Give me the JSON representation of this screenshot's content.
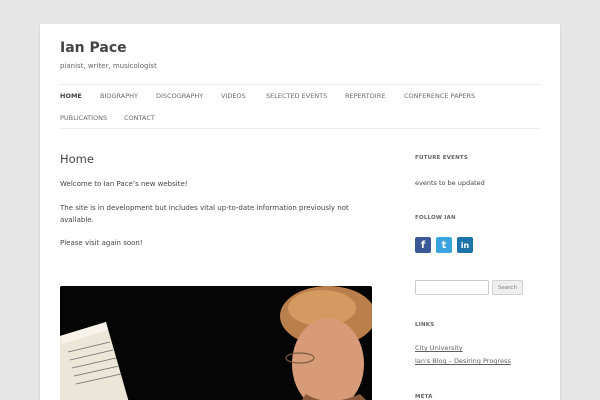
{
  "site": {
    "title": "Ian Pace",
    "description": "pianist, writer, musicologist"
  },
  "nav": {
    "items": [
      {
        "label": "HOME",
        "current": true
      },
      {
        "label": "BIOGRAPHY"
      },
      {
        "label": "DISCOGRAPHY"
      },
      {
        "label": "VIDEOS"
      },
      {
        "label": "SELECTED EVENTS"
      },
      {
        "label": "REPERTOIRE"
      },
      {
        "label": "CONFERENCE PAPERS"
      },
      {
        "label": "PUBLICATIONS"
      },
      {
        "label": "CONTACT"
      }
    ]
  },
  "content": {
    "title": "Home",
    "paragraphs": [
      "Welcome to Ian Pace’s new website!",
      "The site is in development but includes vital up-to-date information previously not available.",
      "Please visit again soon!"
    ]
  },
  "sidebar": {
    "future_events": {
      "title": "FUTURE EVENTS",
      "text": "events to be updated"
    },
    "follow": {
      "title": "FOLLOW IAN",
      "icons": [
        {
          "name": "facebook-icon",
          "glyph": "f",
          "color": "#3b5998"
        },
        {
          "name": "twitter-icon",
          "glyph": "t",
          "color": "#3aa4de"
        },
        {
          "name": "linkedin-icon",
          "glyph": "in",
          "color": "#1e73aa"
        }
      ]
    },
    "search": {
      "placeholder": "",
      "button": "Search"
    },
    "links": {
      "title": "LINKS",
      "items": [
        "City University",
        "Ian's Blog – Desiring Progress"
      ]
    },
    "meta": {
      "title": "META"
    }
  }
}
